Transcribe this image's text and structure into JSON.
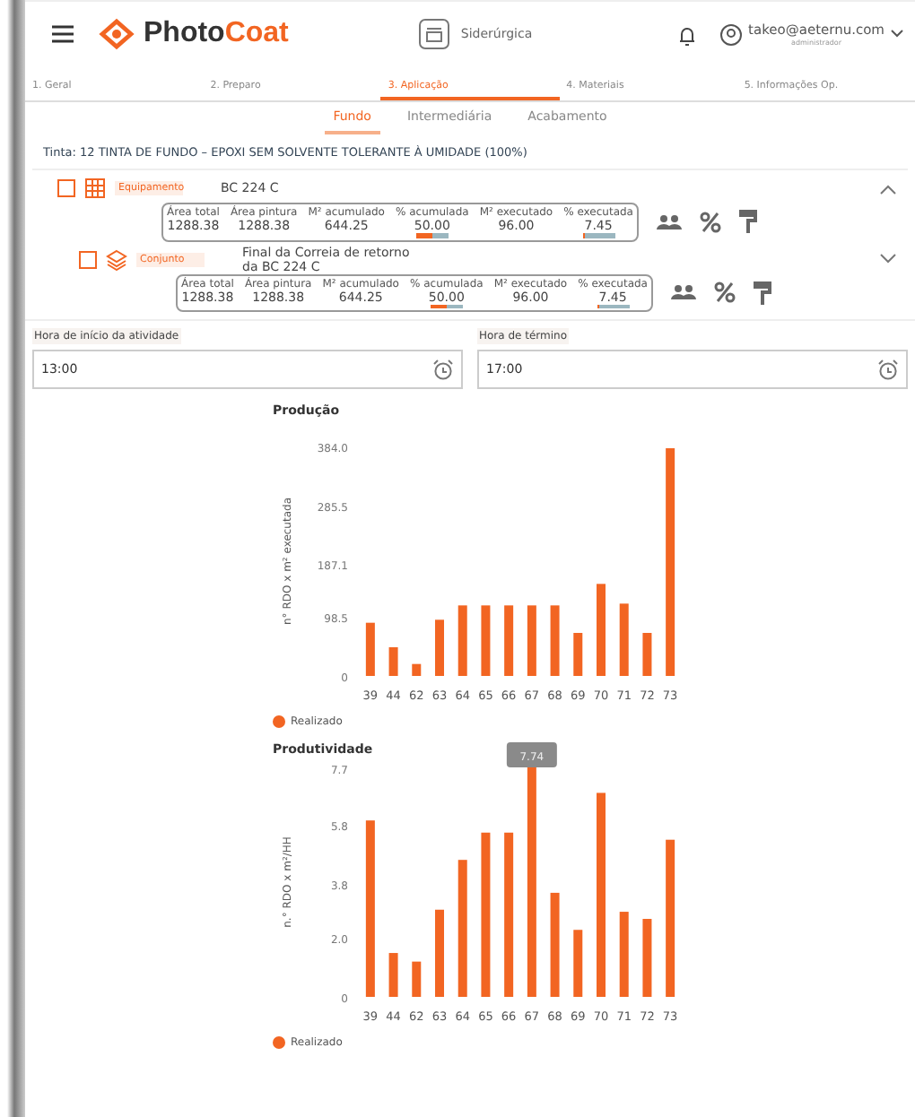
{
  "header": {
    "brand_prefix": "Photo",
    "brand_suffix": "Coat",
    "company": "Siderúrgica",
    "user_email": "takeo@aeternu.com",
    "user_role": "administrador"
  },
  "steps": [
    {
      "label": "1. Geral",
      "selected": false
    },
    {
      "label": "2. Preparo",
      "selected": false
    },
    {
      "label": "3. Aplicação",
      "selected": true
    },
    {
      "label": "4. Materiais",
      "selected": false
    },
    {
      "label": "5. Informações Op.",
      "selected": false
    }
  ],
  "coats": [
    {
      "label": "Fundo",
      "selected": true
    },
    {
      "label": "Intermediária",
      "selected": false
    },
    {
      "label": "Acabamento",
      "selected": false
    }
  ],
  "paint_line": "Tinta: 12 TINTA DE FUNDO – EPOXI  SEM SOLVENTE TOLERANTE À UMIDADE  (100%)",
  "items": [
    {
      "kind": "equipment",
      "type_label": "Equipamento",
      "name": "BC 224 C",
      "checked": false,
      "expanded": true,
      "metrics": [
        {
          "label": "Área total",
          "value": "1288.38"
        },
        {
          "label": "Área pintura",
          "value": "1288.38"
        },
        {
          "label": "M² acumulado",
          "value": "644.25"
        },
        {
          "label": "% acumulada",
          "value": "50.00",
          "level": 0.5
        },
        {
          "label": "M² executado",
          "value": "96.00"
        },
        {
          "label": "% executada",
          "value": "7.45",
          "level": 0.0745
        }
      ]
    },
    {
      "kind": "assembly",
      "type_label": "Conjunto",
      "name": "Final da Correia de retorno da BC 224 C",
      "checked": false,
      "expanded": false,
      "metrics": [
        {
          "label": "Área total",
          "value": "1288.38"
        },
        {
          "label": "Área pintura",
          "value": "1288.38"
        },
        {
          "label": "M² acumulado",
          "value": "644.25"
        },
        {
          "label": "% acumulada",
          "value": "50.00",
          "level": 0.5
        },
        {
          "label": "M² executado",
          "value": "96.00"
        },
        {
          "label": "% executada",
          "value": "7.45",
          "level": 0.0745
        }
      ]
    }
  ],
  "times": [
    {
      "label": "Hora de início da atividade",
      "value": "13:00"
    },
    {
      "label": "Hora de término",
      "value": "17:00"
    }
  ],
  "charts": [
    {
      "chart_data": {
        "type": "bar",
        "title": "Produção",
        "ylabel": "n° RDO x m² executada",
        "categories": [
          "39",
          "44",
          "62",
          "63",
          "64",
          "65",
          "66",
          "67",
          "68",
          "69",
          "70",
          "71",
          "72",
          "73"
        ],
        "series": [
          {
            "name": "Realizado",
            "color": "#f26522",
            "values": [
              89,
              48,
              20,
              94,
              118,
              118,
              118,
              118,
              118,
              72,
              154,
              121,
              72,
              381
            ]
          }
        ],
        "ylim": [
          0,
          384
        ],
        "yticks": [
          0,
          {
            "value": 98.5,
            "label": "98.5"
          },
          {
            "value": 187.1,
            "label": "187.1"
          },
          {
            "value": 285.5,
            "label": "285.5"
          },
          {
            "value": 384,
            "label": "384.0"
          }
        ]
      }
    },
    {
      "tooltip": "7.74",
      "chart_data": {
        "type": "bar",
        "title": "Produtividade",
        "ylabel": "n.° RDO x m²/HH",
        "categories": [
          "39",
          "44",
          "62",
          "63",
          "64",
          "65",
          "66",
          "67",
          "68",
          "69",
          "70",
          "71",
          "72",
          "73"
        ],
        "series": [
          {
            "name": "Realizado",
            "color": "#f26522",
            "values": [
              5.95,
              1.48,
              1.19,
              2.94,
              4.62,
              5.54,
              5.54,
              7.74,
              3.51,
              2.26,
              6.88,
              2.87,
              2.63,
              5.3
            ]
          }
        ],
        "ylim": [
          0,
          7.74
        ],
        "yticks": [
          0,
          {
            "value": 2,
            "label": "2.0"
          },
          {
            "value": 3.8,
            "label": "3.8"
          },
          {
            "value": 5.8,
            "label": "5.8"
          },
          {
            "value": 7.7,
            "label": "7.7"
          }
        ]
      }
    }
  ]
}
